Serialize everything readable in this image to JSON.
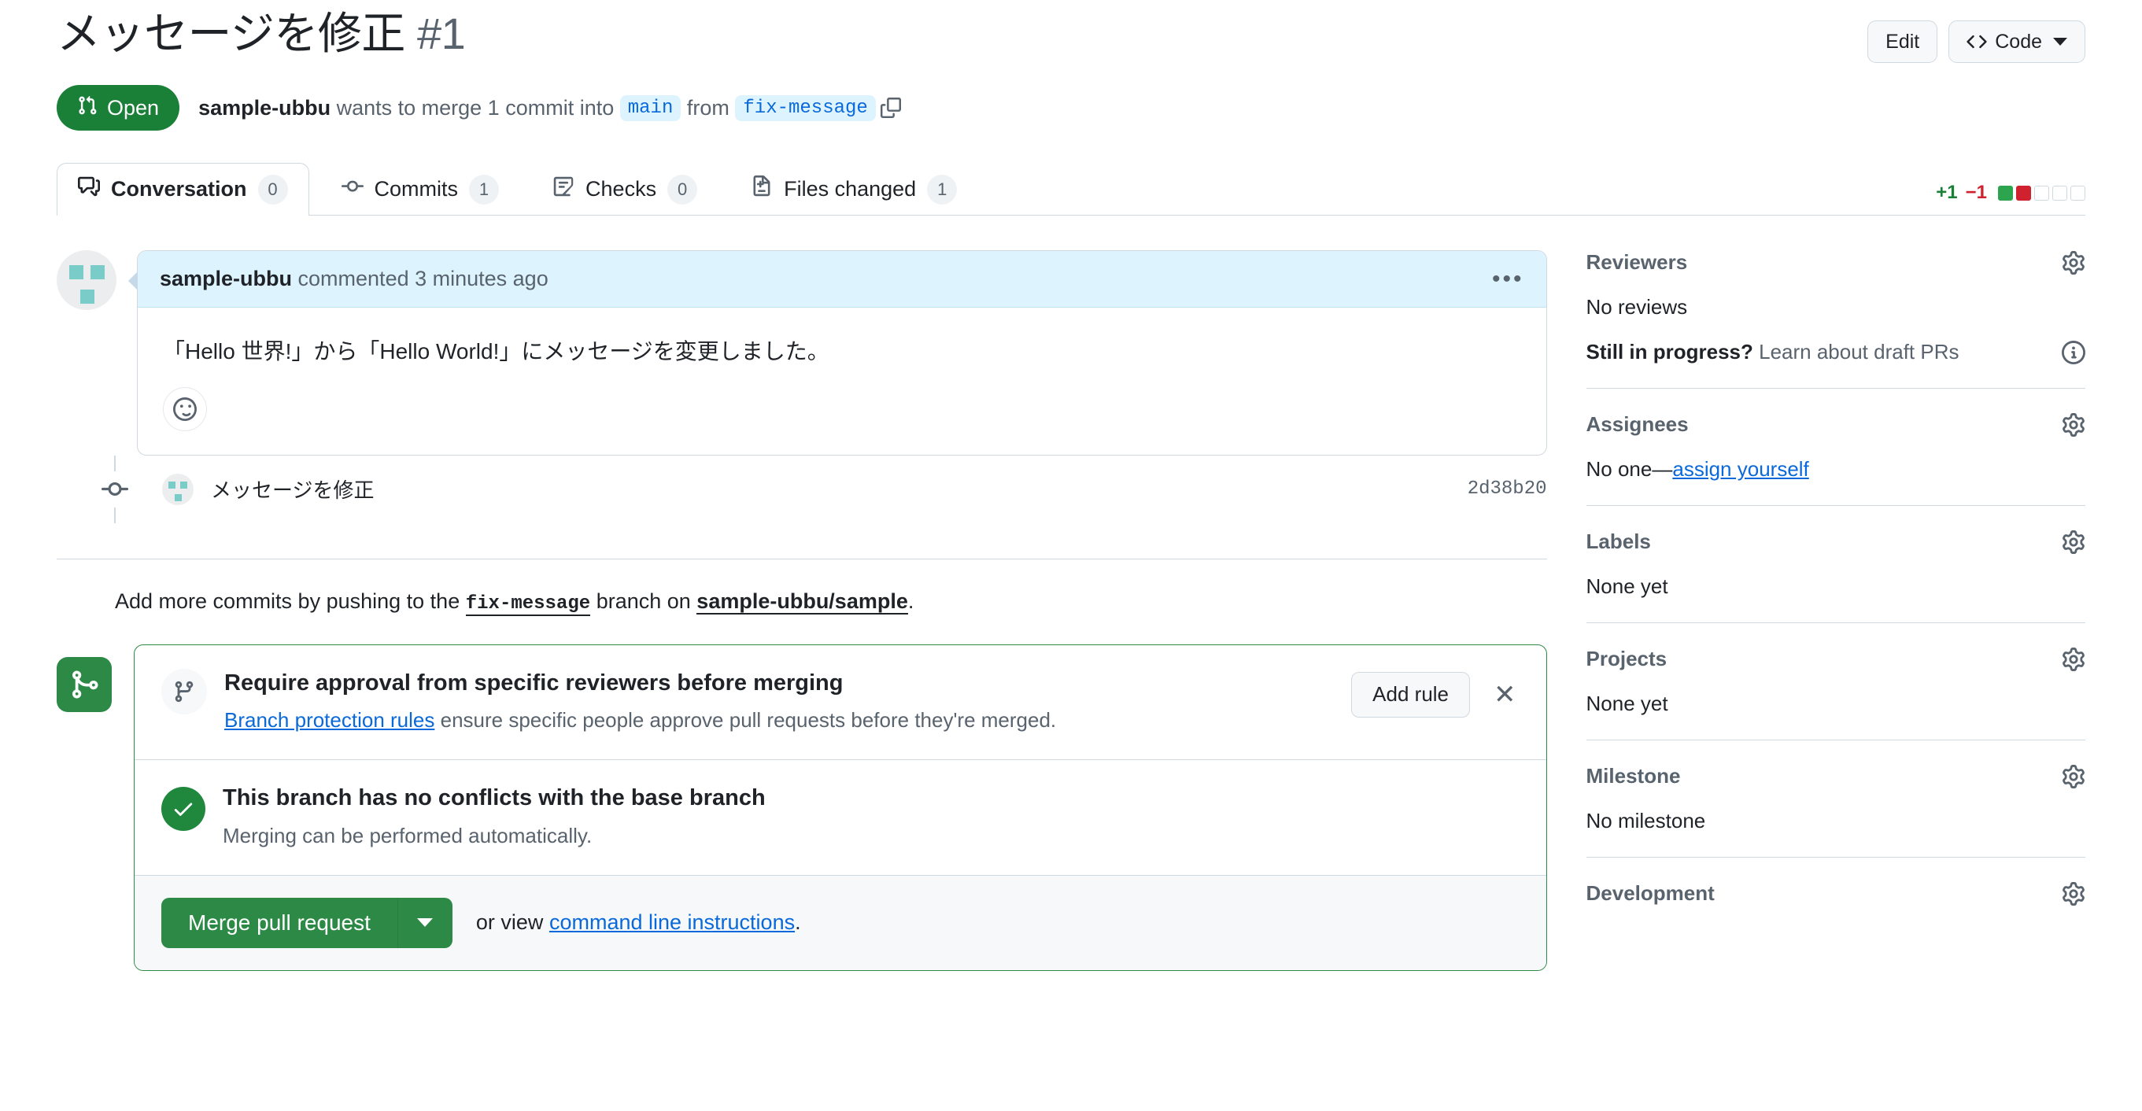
{
  "header": {
    "title": "メッセージを修正",
    "number": "#1",
    "edit_label": "Edit",
    "code_label": "Code",
    "code_icon": "code-brackets-icon",
    "chevron_icon": "chevron-down-icon"
  },
  "meta": {
    "state_label": "Open",
    "state_icon": "git-pull-request-icon",
    "state_color": "#1a7f37",
    "author": "sample-ubbu",
    "text_1": "wants to merge 1 commit into",
    "base_branch": "main",
    "text_2": "from",
    "head_branch": "fix-message",
    "copy_icon": "copy-icon"
  },
  "tabs": [
    {
      "label": "Conversation",
      "count": "0",
      "icon": "comment-discussion-icon",
      "active": true
    },
    {
      "label": "Commits",
      "count": "1",
      "icon": "git-commit-icon",
      "active": false
    },
    {
      "label": "Checks",
      "count": "0",
      "icon": "checklist-icon",
      "active": false
    },
    {
      "label": "Files changed",
      "count": "1",
      "icon": "file-diff-icon",
      "active": false
    }
  ],
  "diffstat": {
    "additions": "+1",
    "deletions": "−1",
    "blocks": [
      "g",
      "r",
      "n",
      "n",
      "n"
    ],
    "add_color": "#1a7f37",
    "del_color": "#cf222e"
  },
  "comment": {
    "author": "sample-ubbu",
    "action": "commented 3 minutes ago",
    "kebab_icon": "kebab-horizontal-icon",
    "body": "「Hello 世界!」から「Hello World!」にメッセージを変更しました。",
    "reaction_icon": "smiley-icon",
    "header_bg": "#ddf4ff"
  },
  "timeline": {
    "commit_icon": "git-commit-icon",
    "commit_message": "メッセージを修正",
    "commit_sha": "2d38b20"
  },
  "push_note": {
    "prefix": "Add more commits by pushing to the",
    "branch": "fix-message",
    "middle": "branch on",
    "repo": "sample-ubbu/sample",
    "suffix": "."
  },
  "merge": {
    "badge_icon": "git-merge-icon",
    "badge_color": "#2d8a46",
    "rule": {
      "icon": "git-branch-icon",
      "title": "Require approval from specific reviewers before merging",
      "link_text": "Branch protection rules",
      "description": "ensure specific people approve pull requests before they're merged.",
      "add_rule_label": "Add rule",
      "close_icon": "close-icon"
    },
    "conflicts": {
      "icon": "check-icon",
      "title": "This branch has no conflicts with the base branch",
      "subtitle": "Merging can be performed automatically."
    },
    "footer": {
      "merge_label": "Merge pull request",
      "split_icon": "chevron-down-icon",
      "or_view": "or view",
      "cli_link": "command line instructions",
      "period": "."
    }
  },
  "sidebar": [
    {
      "title": "Reviewers",
      "gear_icon": "gear-icon",
      "value": "No reviews",
      "extra_prefix": "Still in progress?",
      "extra_link": "Learn about draft PRs",
      "extra_icon": "info-icon"
    },
    {
      "title": "Assignees",
      "gear_icon": "gear-icon",
      "value_prefix": "No one—",
      "value_link": "assign yourself"
    },
    {
      "title": "Labels",
      "gear_icon": "gear-icon",
      "value": "None yet"
    },
    {
      "title": "Projects",
      "gear_icon": "gear-icon",
      "value": "None yet"
    },
    {
      "title": "Milestone",
      "gear_icon": "gear-icon",
      "value": "No milestone"
    },
    {
      "title": "Development",
      "gear_icon": "gear-icon",
      "value": ""
    }
  ]
}
